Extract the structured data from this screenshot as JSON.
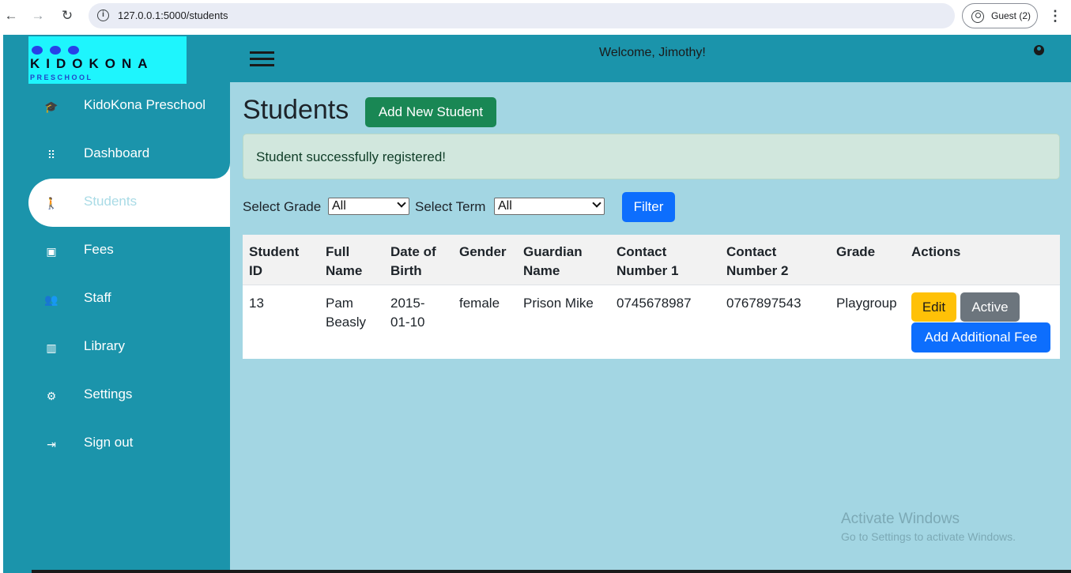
{
  "browser": {
    "url": "127.0.0.1:5000/students",
    "profile_label": "Guest (2)",
    "back_icon": "←",
    "forward_icon": "→",
    "reload_icon": "↻",
    "info_icon": "i",
    "menu_icon": "⋮"
  },
  "logo": {
    "name": "KIDOKONA",
    "subtitle": "PRESCHOOL"
  },
  "topbar": {
    "welcome": "Welcome, Jimothy!"
  },
  "sidebar": {
    "items": [
      {
        "label": "KidoKona Preschool",
        "icon": "graduation-cap-icon",
        "glyph": "🎓"
      },
      {
        "label": "Dashboard",
        "icon": "grid-icon",
        "glyph": "⠿"
      },
      {
        "label": "Students",
        "icon": "child-icon",
        "glyph": "🚶"
      },
      {
        "label": "Fees",
        "icon": "wallet-icon",
        "glyph": "▣"
      },
      {
        "label": "Staff",
        "icon": "users-icon",
        "glyph": "👥"
      },
      {
        "label": "Library",
        "icon": "books-icon",
        "glyph": "▥"
      },
      {
        "label": "Settings",
        "icon": "gear-icon",
        "glyph": "⚙"
      },
      {
        "label": "Sign out",
        "icon": "sign-out-icon",
        "glyph": "⇥"
      }
    ],
    "active_index": 2
  },
  "main": {
    "title": "Students",
    "add_button": "Add New Student",
    "alert": "Student successfully registered!",
    "filters": {
      "grade_label": "Select Grade",
      "grade_value": "All",
      "term_label": "Select Term",
      "term_value": "All",
      "button": "Filter"
    },
    "table": {
      "headers": [
        {
          "line1": "Student",
          "line2": "ID"
        },
        {
          "line1": "Full",
          "line2": "Name"
        },
        {
          "line1": "Date of",
          "line2": "Birth"
        },
        {
          "line1": "Gender",
          "line2": ""
        },
        {
          "line1": "Guardian",
          "line2": "Name"
        },
        {
          "line1": "Contact",
          "line2": "Number 1"
        },
        {
          "line1": "Contact",
          "line2": "Number 2"
        },
        {
          "line1": "Grade",
          "line2": ""
        },
        {
          "line1": "Actions",
          "line2": ""
        }
      ],
      "rows": [
        {
          "student_id": "13",
          "full_name_1": "Pam",
          "full_name_2": "Beasly",
          "dob_1": "2015-",
          "dob_2": "01-10",
          "gender": "female",
          "guardian": "Prison Mike",
          "contact1": "0745678987",
          "contact2": "0767897543",
          "grade": "Playgroup",
          "edit_label": "Edit",
          "status_label": "Active",
          "fee_label": "Add Additional Fee"
        }
      ]
    }
  },
  "watermark": {
    "line1": "Activate Windows",
    "line2": "Go to Settings to activate Windows."
  },
  "colors": {
    "sidebar": "#1b94ab",
    "main_bg": "#a3d6e3",
    "success": "#198754",
    "primary": "#0d6efd",
    "warning": "#ffc107",
    "secondary": "#6c757d"
  }
}
